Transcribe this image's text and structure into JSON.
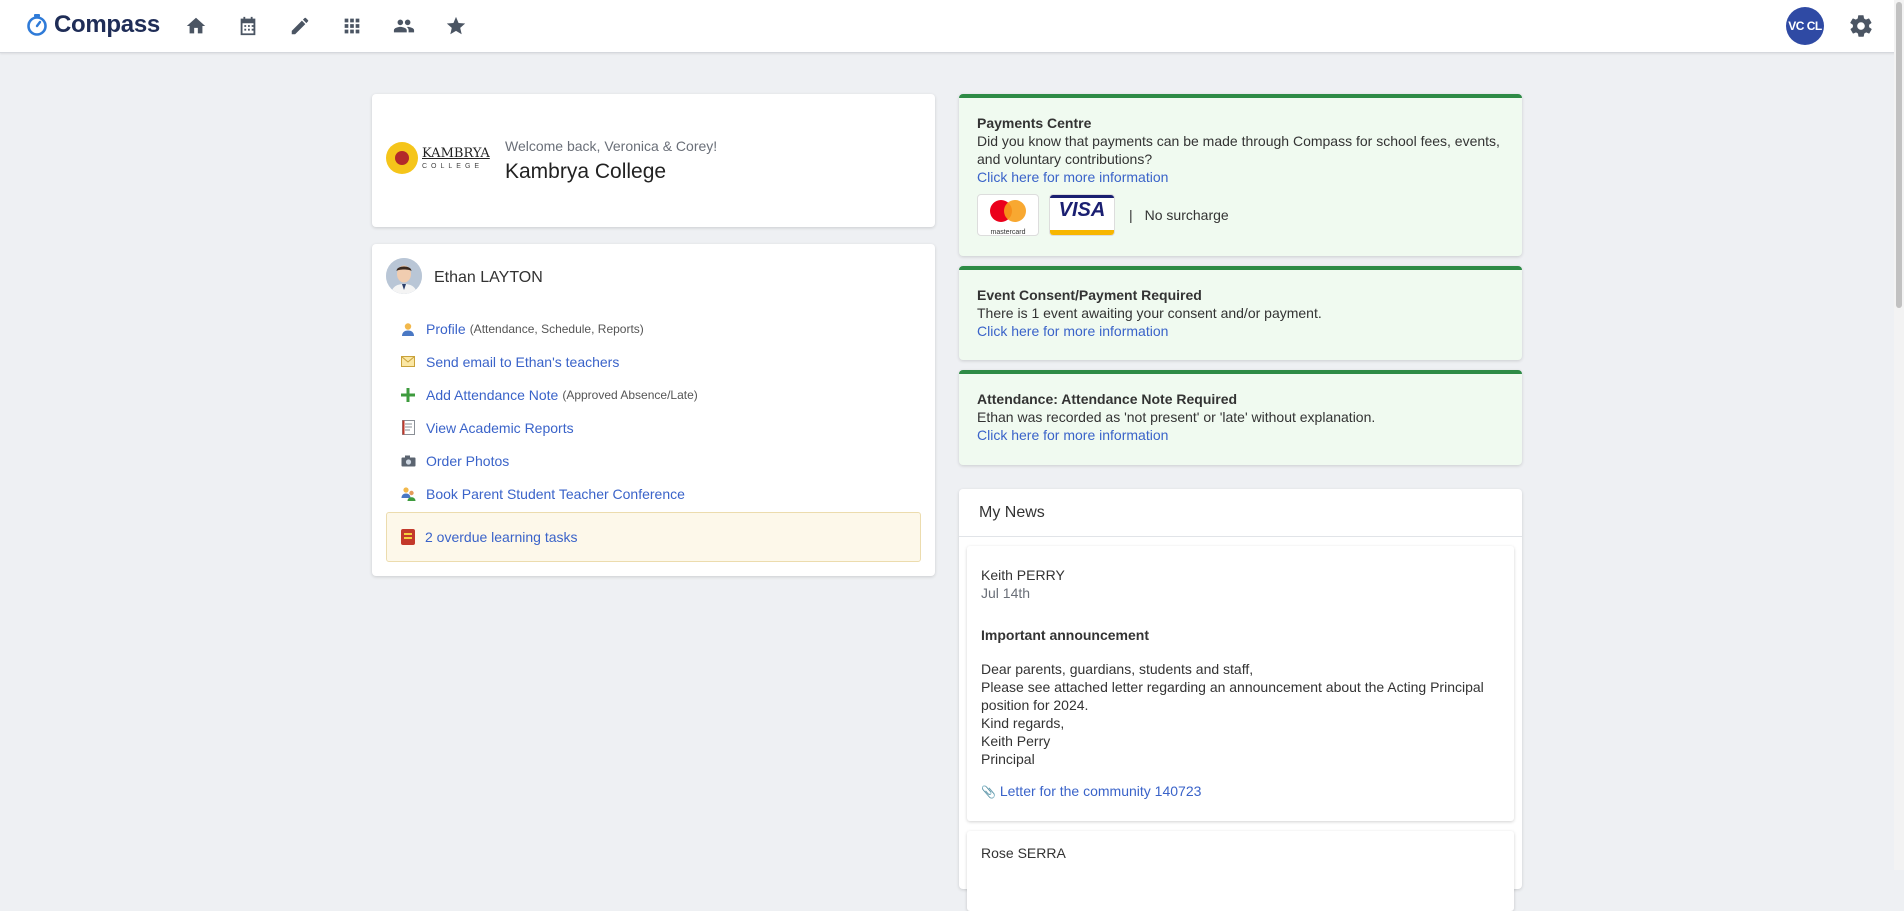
{
  "app": {
    "name": "Compass"
  },
  "nav": {
    "icons": [
      "home-icon",
      "calendar-icon",
      "pencil-icon",
      "apps-grid-icon",
      "people-icon",
      "star-icon"
    ]
  },
  "user": {
    "initials": "VC CL"
  },
  "welcome": {
    "message": "Welcome back, Veronica & Corey!",
    "school_name": "Kambrya College",
    "logo_word": "KAMBRYA",
    "logo_sub": "COLLEGE"
  },
  "student": {
    "name": "Ethan LAYTON",
    "actions": [
      {
        "label": "Profile",
        "note": "(Attendance, Schedule, Reports)",
        "icon": "profile-icon"
      },
      {
        "label": "Send email to Ethan's teachers",
        "note": "",
        "icon": "email-icon"
      },
      {
        "label": "Add Attendance Note",
        "note": "(Approved Absence/Late)",
        "icon": "plus-icon"
      },
      {
        "label": "View Academic Reports",
        "note": "",
        "icon": "report-icon"
      },
      {
        "label": "Order Photos",
        "note": "",
        "icon": "camera-icon"
      },
      {
        "label": "Book Parent Student Teacher Conference",
        "note": "",
        "icon": "conference-icon"
      }
    ],
    "overdue": "2 overdue learning tasks"
  },
  "alerts": {
    "payments": {
      "title": "Payments Centre",
      "body": "Did you know that payments can be made through Compass for school fees, events, and voluntary contributions?",
      "link": "Click here for more information",
      "mastercard_label": "mastercard",
      "visa_label": "VISA",
      "separator": "|",
      "surcharge": "No surcharge"
    },
    "event": {
      "title": "Event Consent/Payment Required",
      "body": "There is 1 event awaiting your consent and/or payment.",
      "link": "Click here for more information"
    },
    "attendance": {
      "title": "Attendance: Attendance Note Required",
      "body": "Ethan was recorded as 'not present' or 'late' without explanation.",
      "link": "Click here for more information"
    }
  },
  "news": {
    "heading": "My News",
    "items": [
      {
        "author": "Keith PERRY",
        "date": "Jul 14th",
        "title": "Important announcement",
        "body": "Dear parents, guardians, students and staff,\nPlease see attached letter regarding an announcement about the Acting Principal position for 2024.\nKind regards,\nKeith Perry\nPrincipal",
        "attachment": "Letter for the community 140723"
      },
      {
        "author": "Rose SERRA"
      }
    ]
  },
  "colors": {
    "accent": "#3a63c9",
    "alert_border": "#2e8b46",
    "alert_bg": "#f0faf0",
    "avatar": "#2f4aa4"
  }
}
